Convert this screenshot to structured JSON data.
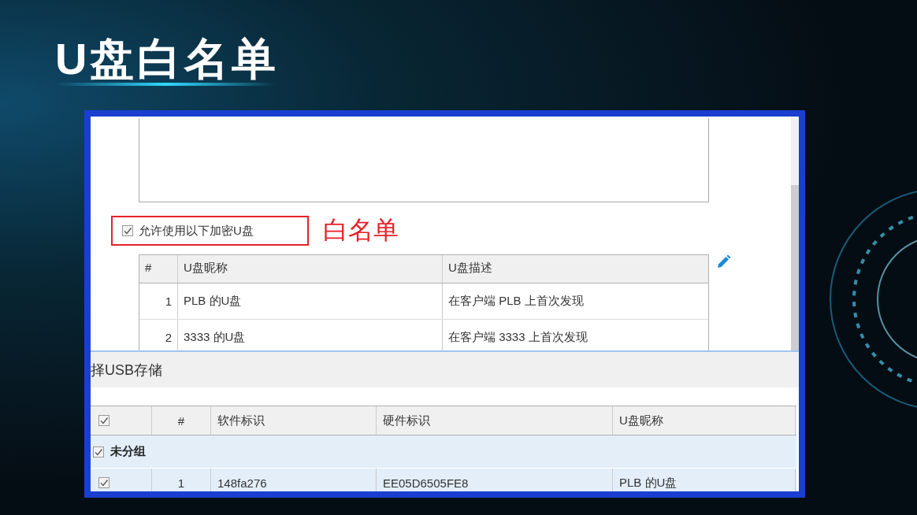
{
  "slide_title": "U盘白名单",
  "whitelist": {
    "checkbox": {
      "label": "允许使用以下加密U盘",
      "checked": true
    },
    "annotation": "白名单",
    "columns": [
      "#",
      "U盘昵称",
      "U盘描述"
    ],
    "rows": [
      {
        "index": "1",
        "name": "PLB 的U盘",
        "description": "在客户端 PLB 上首次发现"
      },
      {
        "index": "2",
        "name": "3333 的U盘",
        "description": "在客户端 3333 上首次发现"
      }
    ]
  },
  "usb_storage": {
    "title": "择USB存储",
    "select_all_checked": true,
    "columns": [
      "#",
      "软件标识",
      "硬件标识",
      "U盘昵称"
    ],
    "groups": [
      {
        "name": "未分组",
        "checked": true,
        "rows": [
          {
            "checked": true,
            "index": "1",
            "software_id": "148fa276",
            "hardware_id": "EE05D6505FE8",
            "name": "PLB 的U盘"
          }
        ]
      }
    ]
  }
}
